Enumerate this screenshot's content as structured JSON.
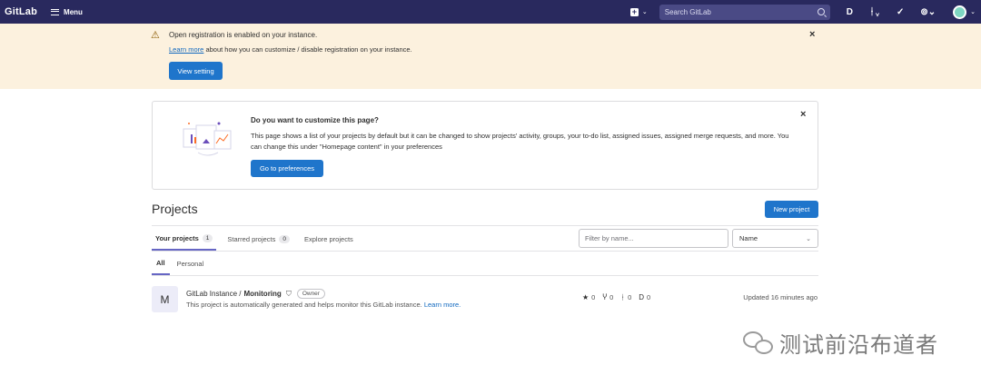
{
  "topbar": {
    "logo": "GitLab",
    "menu_label": "Menu",
    "search_placeholder": "Search GitLab"
  },
  "alert": {
    "title": "Open registration is enabled on your instance.",
    "link": "Learn more",
    "body_rest": " about how you can customize / disable registration on your instance.",
    "button": "View setting"
  },
  "customize": {
    "title": "Do you want to customize this page?",
    "text": "This page shows a list of your projects by default but it can be changed to show projects' activity, groups, your to-do list, assigned issues, assigned merge requests, and more. You can change this under \"Homepage content\" in your preferences",
    "button": "Go to preferences"
  },
  "projects": {
    "title": "Projects",
    "new_button": "New project",
    "tabs": [
      {
        "label": "Your projects",
        "count": "1"
      },
      {
        "label": "Starred projects",
        "count": "0"
      },
      {
        "label": "Explore projects",
        "count": ""
      }
    ],
    "filter_placeholder": "Filter by name...",
    "sort_value": "Name",
    "subtabs": [
      "All",
      "Personal"
    ]
  },
  "project": {
    "avatar_letter": "M",
    "namespace": "GitLab Instance /",
    "name": "Monitoring",
    "role": "Owner",
    "description": "This project is automatically generated and helps monitor this GitLab instance.",
    "desc_link": "Learn more.",
    "stars": "0",
    "forks": "0",
    "merge_requests": "0",
    "issues": "0",
    "updated": "Updated 16 minutes ago"
  },
  "watermark": {
    "text": "测试前沿布道者"
  },
  "colors": {
    "nav": "#29295e",
    "alert_bg": "#fcf1de",
    "primary": "#1f75cb",
    "tab_underline": "#6666c4"
  }
}
